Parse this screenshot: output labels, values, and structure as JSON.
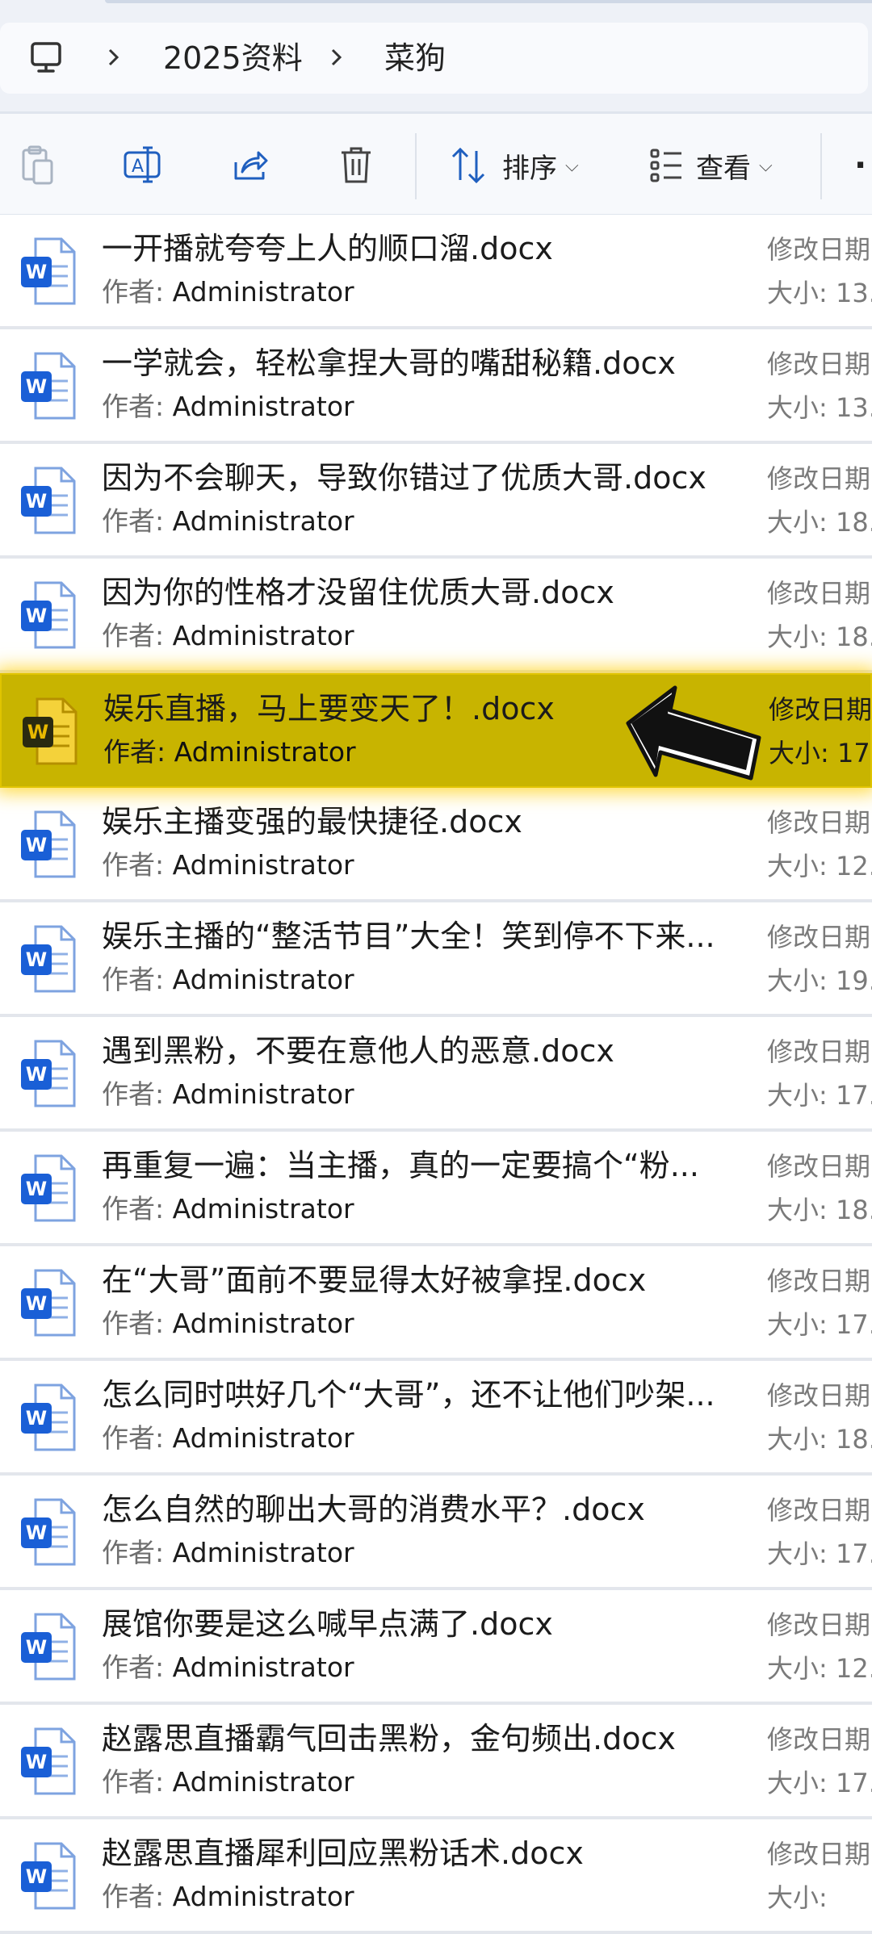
{
  "breadcrumb": {
    "items": [
      "2025资料",
      "菜狗"
    ]
  },
  "toolbar": {
    "sort_label": "排序",
    "view_label": "查看",
    "more_label": "·"
  },
  "meta_labels": {
    "modified": "修改日期",
    "author_key": "作者:",
    "size_key": "大小:"
  },
  "files": [
    {
      "title": "一开播就夸夸上人的顺口溜.docx",
      "author": "Administrator",
      "size": "13."
    },
    {
      "title": "一学就会，轻松拿捏大哥的嘴甜秘籍.docx",
      "author": "Administrator",
      "size": "13."
    },
    {
      "title": "因为不会聊天，导致你错过了优质大哥.docx",
      "author": "Administrator",
      "size": "18."
    },
    {
      "title": "因为你的性格才没留住优质大哥.docx",
      "author": "Administrator",
      "size": "18."
    },
    {
      "title": "娱乐直播，马上要变天了！.docx",
      "author": "Administrator",
      "size": "17.",
      "highlighted": true
    },
    {
      "title": "娱乐主播变强的最快捷径.docx",
      "author": "Administrator",
      "size": "12."
    },
    {
      "title": "娱乐主播的“整活节目”大全！笑到停不下来...",
      "author": "Administrator",
      "size": "19."
    },
    {
      "title": "遇到黑粉，不要在意他人的恶意.docx",
      "author": "Administrator",
      "size": "17."
    },
    {
      "title": "再重复一遍：当主播，真的一定要搞个“粉...",
      "author": "Administrator",
      "size": "18."
    },
    {
      "title": "在“大哥”面前不要显得太好被拿捏.docx",
      "author": "Administrator",
      "size": "17."
    },
    {
      "title": "怎么同时哄好几个“大哥”，还不让他们吵架...",
      "author": "Administrator",
      "size": "18."
    },
    {
      "title": "怎么自然的聊出大哥的消费水平？.docx",
      "author": "Administrator",
      "size": "17."
    },
    {
      "title": "展馆你要是这么喊早点满了.docx",
      "author": "Administrator",
      "size": "12."
    },
    {
      "title": "赵露思直播霸气回击黑粉，金句频出.docx",
      "author": "Administrator",
      "size": "17."
    },
    {
      "title": "赵露思直播犀利回应黑粉话术.docx",
      "author": "Administrator",
      "size": ""
    }
  ],
  "colors": {
    "highlight": "#c8b400",
    "word_blue": "#1a5fd6",
    "word_yellow": "#e8b800"
  }
}
